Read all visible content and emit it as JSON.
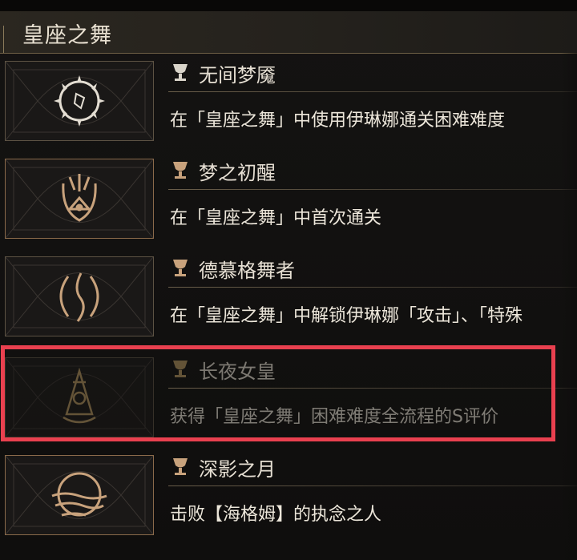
{
  "header": {
    "title": "皇座之舞"
  },
  "achievements": [
    {
      "name": "无间梦魇",
      "desc": "在「皇座之舞」中使用伊琳娜通关困难难度",
      "icon": "spiked-eye-emblem-icon",
      "tier": "silver",
      "locked": false
    },
    {
      "name": "梦之初醒",
      "desc": "在「皇座之舞」中首次通关",
      "icon": "awakening-eye-emblem-icon",
      "tier": "bronze",
      "locked": false
    },
    {
      "name": "德慕格舞者",
      "desc": "在「皇座之舞」中解锁伊琳娜「攻击」、「特殊",
      "icon": "dancer-crescent-emblem-icon",
      "tier": "bronze",
      "locked": false
    },
    {
      "name": "长夜女皇",
      "desc": "获得「皇座之舞」困难难度全流程的S评价",
      "icon": "empress-crown-emblem-icon",
      "tier": "gold",
      "locked": true
    },
    {
      "name": "深影之月",
      "desc": "击败【海格姆】的执念之人",
      "icon": "shadow-moon-emblem-icon",
      "tier": "bronze",
      "locked": false
    }
  ],
  "colors": {
    "highlight": "#e9404f",
    "silver": "#d9d4ca",
    "bronze": "#c8a27c",
    "gold": "#b59660"
  }
}
